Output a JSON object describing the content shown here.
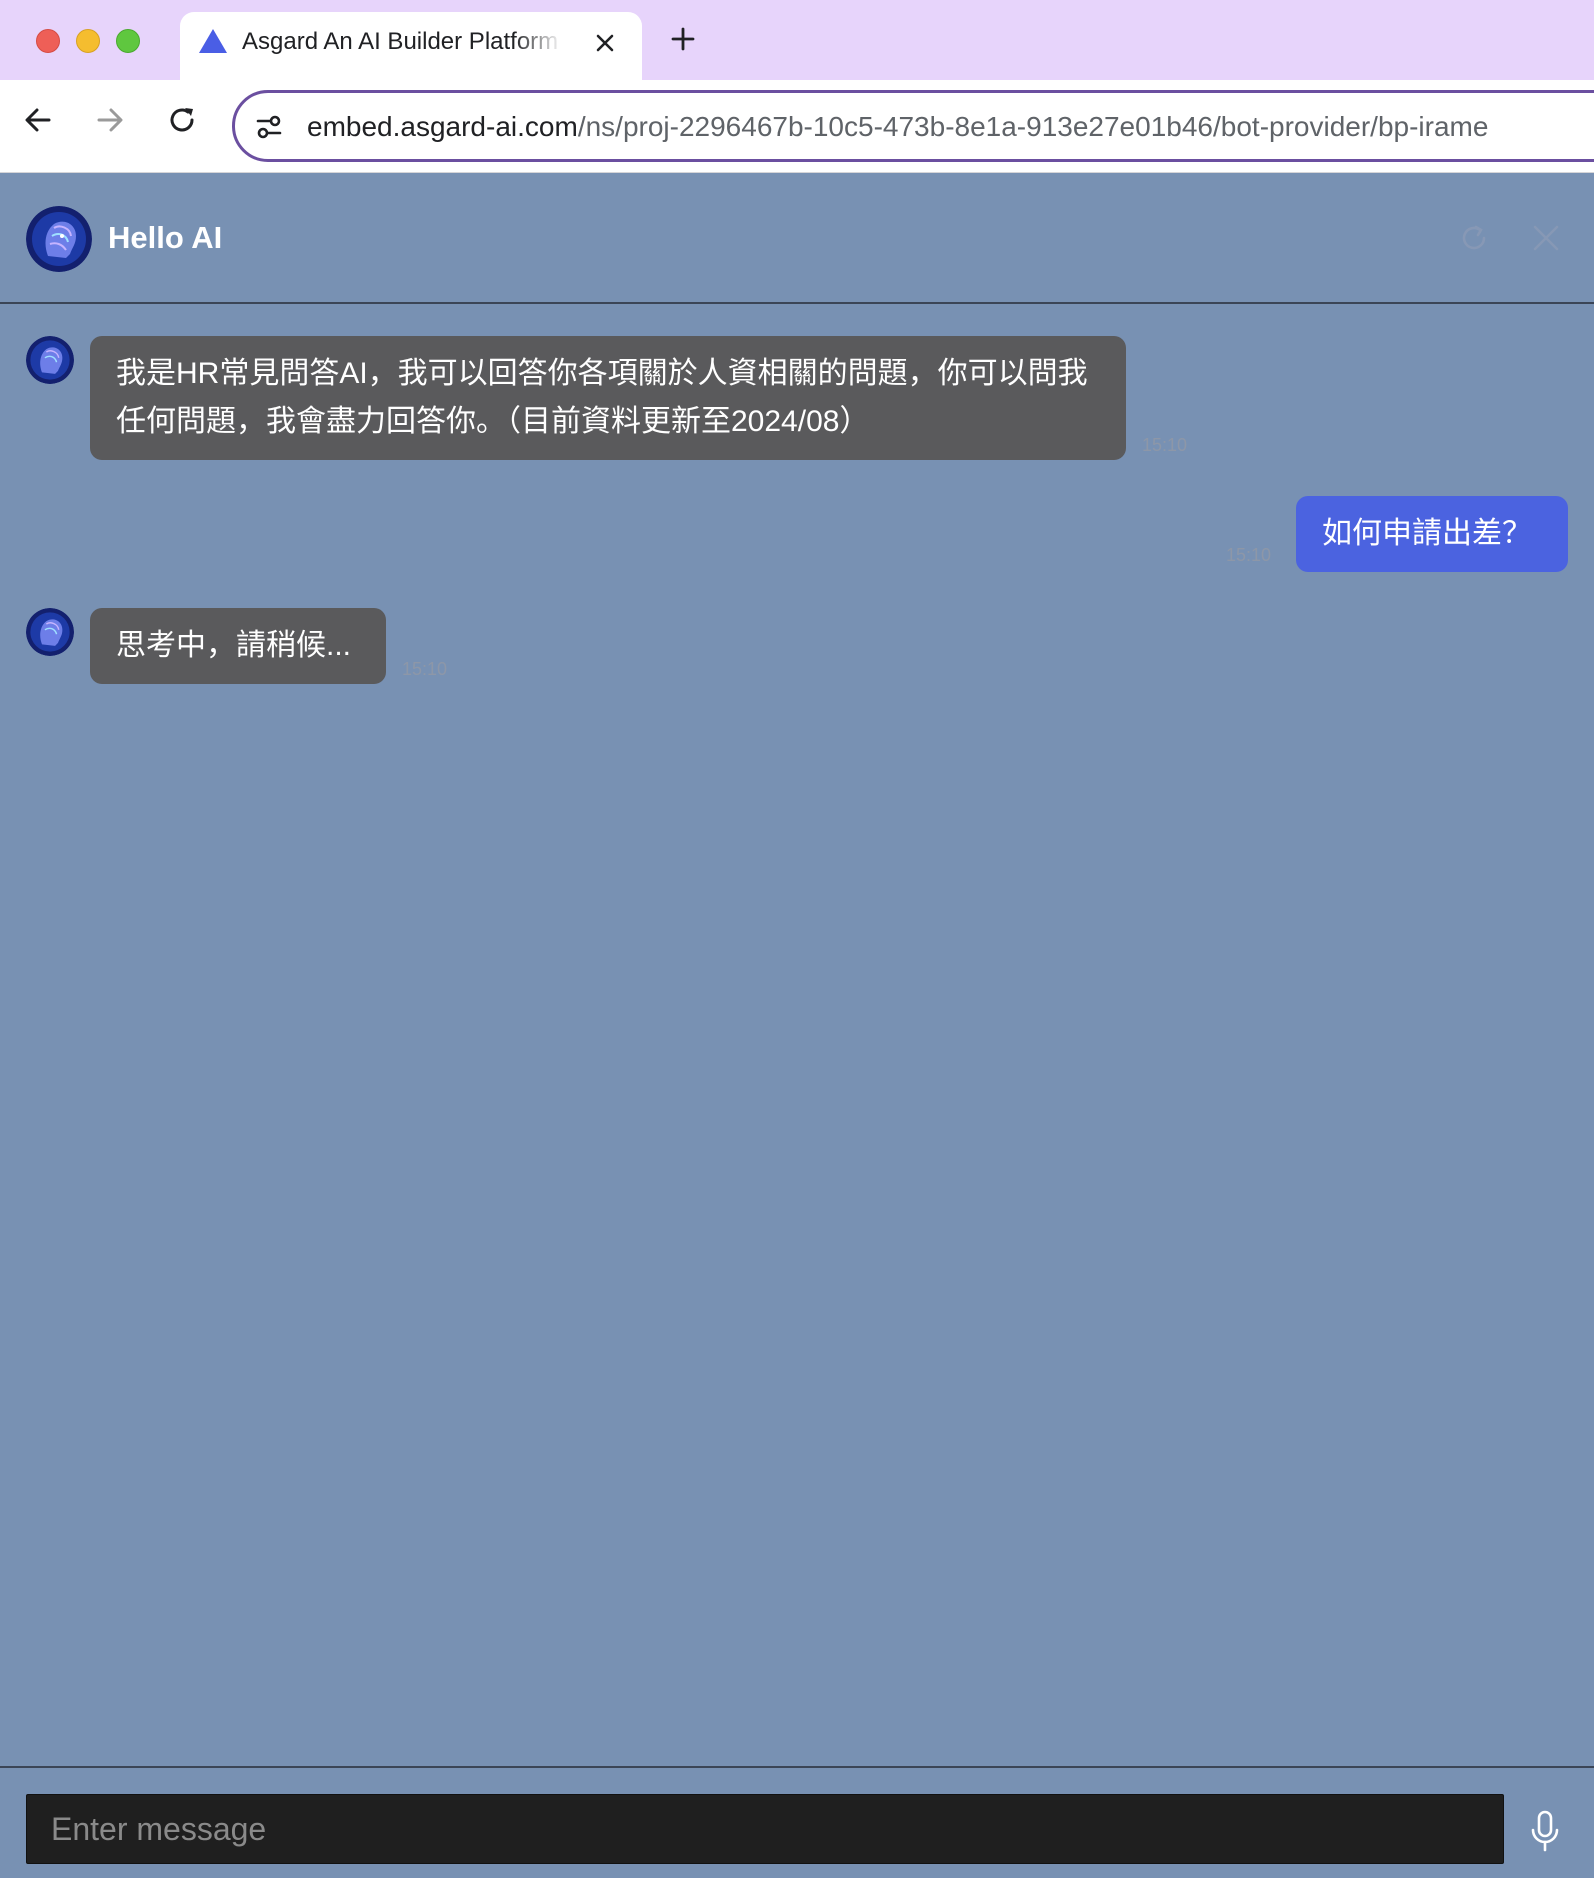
{
  "browser": {
    "tab_title": "Asgard An AI Builder Platform",
    "url_host": "embed.asgard-ai.com",
    "url_path": "/ns/proj-2296467b-10c5-473b-8e1a-913e27e01b46/bot-provider/bp-irame"
  },
  "chat": {
    "bot_name": "Hello AI",
    "messages": [
      {
        "role": "bot",
        "text": "我是HR常見問答AI，我可以回答你各項關於人資相關的問題，你可以問我任何問題，我會盡力回答你。（目前資料更新至2024/08）",
        "time": "15:10"
      },
      {
        "role": "user",
        "text": "如何申請出差？",
        "time": "15:10"
      },
      {
        "role": "bot",
        "text": "思考中，請稍候...",
        "time": "15:10"
      }
    ],
    "input_placeholder": "Enter message",
    "input_value": ""
  },
  "colors": {
    "tabbar_bg": "#e7d4fb",
    "chat_bg": "#7891b3",
    "bot_bubble": "#5a5a5c",
    "user_bubble": "#4b63e0",
    "input_bg": "#1f1f1f"
  },
  "icons": {
    "favicon": "asgard-triangle-icon",
    "refresh": "refresh-icon",
    "close": "close-icon",
    "mic": "microphone-icon"
  }
}
